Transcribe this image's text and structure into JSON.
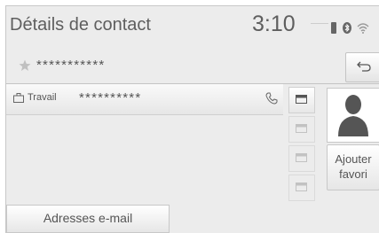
{
  "header": {
    "title": "Détails de contact",
    "clock": "3:10"
  },
  "status_icons": [
    "phone-signal-icon",
    "bluetooth-icon",
    "wifi-icon"
  ],
  "contact": {
    "name": "***********",
    "favorite_icon": "star-icon"
  },
  "phone": {
    "type": "Travail",
    "number": "**********",
    "icons": [
      "briefcase-icon",
      "call-icon"
    ]
  },
  "buttons": {
    "add_favorite": "Ajouter\nfavori",
    "email_addresses": "Adresses e-mail",
    "back_icon": "back-arrow-icon"
  },
  "mail_buttons": [
    {
      "enabled": true
    },
    {
      "enabled": false
    },
    {
      "enabled": false
    },
    {
      "enabled": false
    }
  ],
  "colors": {
    "background": "#ececec",
    "text": "#555555"
  }
}
